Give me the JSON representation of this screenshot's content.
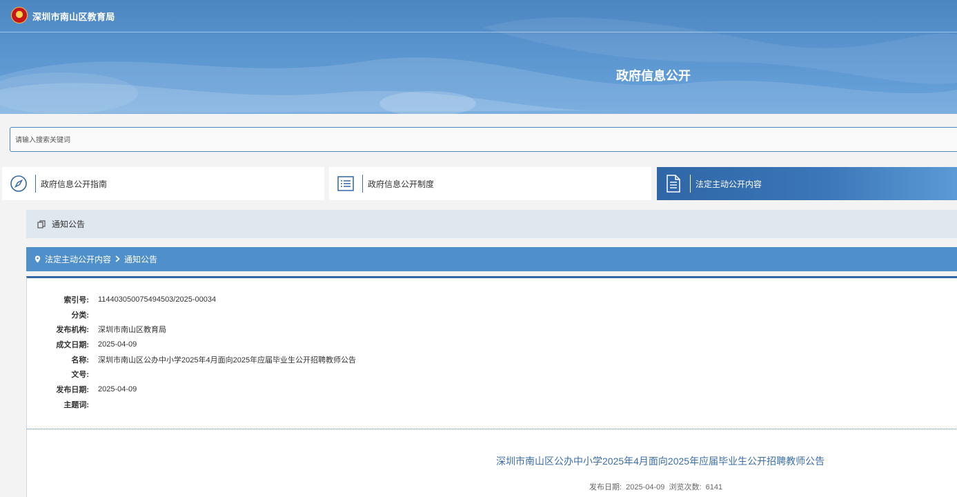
{
  "header": {
    "site_name": "深圳市南山区教育局",
    "title": "政府信息公开"
  },
  "search": {
    "placeholder": "请输入搜索关键词"
  },
  "nav": [
    {
      "label": "政府信息公开指南",
      "icon": "compass-icon",
      "active": false
    },
    {
      "label": "政府信息公开制度",
      "icon": "list-icon",
      "active": false
    },
    {
      "label": "法定主动公开内容",
      "icon": "document-icon",
      "active": true
    }
  ],
  "section": {
    "title": "通知公告",
    "icon": "copy-icon"
  },
  "breadcrumb": {
    "items": [
      "法定主动公开内容",
      "通知公告"
    ]
  },
  "meta": [
    {
      "key": "索引号:",
      "value": "114403050075494503/2025-00034"
    },
    {
      "key": "分类:",
      "value": ""
    },
    {
      "key": "发布机构:",
      "value": "深圳市南山区教育局"
    },
    {
      "key": "成文日期:",
      "value": "2025-04-09"
    },
    {
      "key": "名称:",
      "value": "深圳市南山区公办中小学2025年4月面向2025年应届毕业生公开招聘教师公告"
    },
    {
      "key": "文号:",
      "value": ""
    },
    {
      "key": "发布日期:",
      "value": "2025-04-09"
    },
    {
      "key": "主题词:",
      "value": ""
    }
  ],
  "document": {
    "title": "深圳市南山区公办中小学2025年4月面向2025年应届毕业生公开招聘教师公告",
    "publish_label": "发布日期:",
    "publish_date": "2025-04-09",
    "views_label": "浏览次数:",
    "views": "6141"
  },
  "colors": {
    "primary": "#2f66a6",
    "breadcrumb": "#4f8fca",
    "section_bg": "#dfe7ef",
    "title_link": "#3b6ea8"
  }
}
